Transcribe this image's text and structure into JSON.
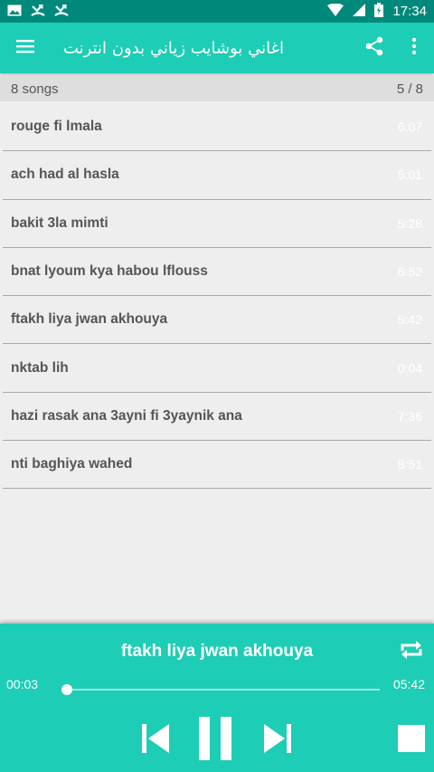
{
  "status_bar": {
    "time": "17:34",
    "left_icons": [
      "image-icon",
      "missed-call-icon",
      "missed-call-icon"
    ],
    "right_icons": [
      "wifi-icon",
      "signal-icon",
      "battery-icon"
    ]
  },
  "app_bar": {
    "title": "اغاني بوشايب زياني بدون انترنت",
    "icons": [
      "menu-icon",
      "share-icon",
      "more-vert-icon"
    ],
    "color": "#1ecdb5"
  },
  "list_header": {
    "count": "8 songs",
    "position": "5 / 8"
  },
  "songs": [
    {
      "title": "rouge fi lmala",
      "duration": "6:07"
    },
    {
      "title": "ach had al hasla",
      "duration": "5:01"
    },
    {
      "title": "bakit 3la mimti",
      "duration": "5:28"
    },
    {
      "title": "bnat lyoum kya habou lflouss",
      "duration": "6:52"
    },
    {
      "title": "ftakh liya jwan akhouya",
      "duration": "5:42"
    },
    {
      "title": "nktab lih",
      "duration": "0:04"
    },
    {
      "title": "hazi rasak ana 3ayni fi 3yaynik ana",
      "duration": "7:36"
    },
    {
      "title": "nti baghiya wahed",
      "duration": "8:51"
    }
  ],
  "player": {
    "now_playing": "ftakh liya jwan akhouya",
    "current_time": "00:03",
    "total_time": "05:42",
    "progress": 0.01,
    "controls": [
      "previous-icon",
      "pause-icon",
      "next-icon",
      "stop-icon",
      "repeat-icon"
    ]
  },
  "colors": {
    "status_bar": "#00897b",
    "accent": "#1ecdb5",
    "background": "#eeeeee"
  }
}
